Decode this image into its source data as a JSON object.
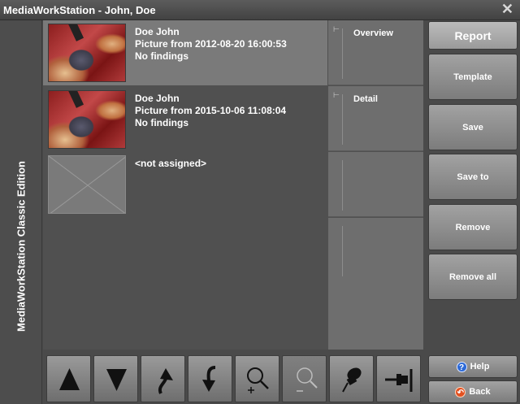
{
  "window": {
    "title": "MediaWorkStation - John, Doe",
    "close_glyph": "✕"
  },
  "sidebar": {
    "text": "MediaWorkStation Classic Edition"
  },
  "pictures": [
    {
      "name": "Doe John",
      "date": "Picture from 2012-08-20 16:00:53",
      "findings": "No findings",
      "selected": true
    },
    {
      "name": "Doe John",
      "date": "Picture from 2015-10-06 11:08:04",
      "findings": "No findings",
      "selected": false
    },
    {
      "name": "<not assigned>",
      "selected": false
    }
  ],
  "slots": [
    {
      "label": "Overview",
      "pin_icon": "pin-icon"
    },
    {
      "label": "Detail",
      "pin_icon": "pin-icon"
    },
    {
      "label": ""
    },
    {
      "label": ""
    }
  ],
  "toolbar": [
    {
      "name": "move-up",
      "icon": "arrow-up-icon",
      "enabled": true
    },
    {
      "name": "move-down",
      "icon": "arrow-down-icon",
      "enabled": true
    },
    {
      "name": "move-to-top",
      "icon": "curved-arrow-up-icon",
      "enabled": true
    },
    {
      "name": "move-to-bottom",
      "icon": "curved-arrow-down-icon",
      "enabled": true
    },
    {
      "name": "zoom-in",
      "icon": "zoom-in-icon",
      "enabled": true
    },
    {
      "name": "zoom-out",
      "icon": "zoom-out-icon",
      "enabled": false
    },
    {
      "name": "pin",
      "icon": "pushpin-icon",
      "enabled": true
    },
    {
      "name": "assign",
      "icon": "pin-slot-icon",
      "enabled": true
    }
  ],
  "actions": {
    "report": "Report",
    "template": "Template",
    "save": "Save",
    "save_to": "Save to",
    "remove": "Remove",
    "remove_all": "Remove all",
    "help": "Help",
    "back": "Back"
  },
  "colors": {
    "selected_row": "#7a7a7a",
    "help_icon": "#2c6ad8",
    "back_icon": "#e25020"
  }
}
